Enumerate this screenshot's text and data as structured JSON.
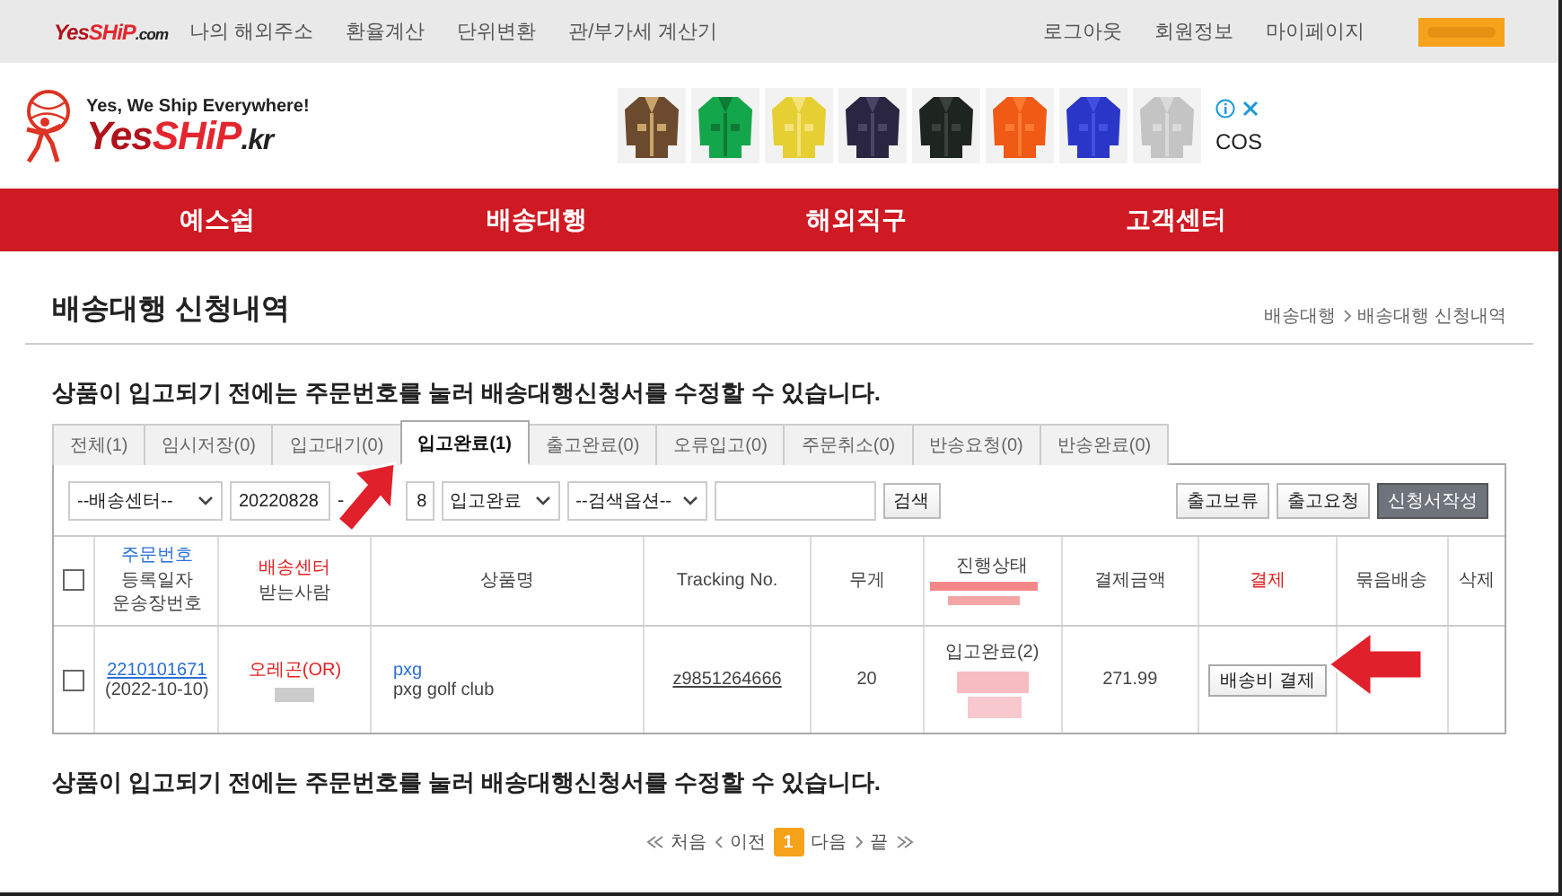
{
  "top_bar": {
    "logo_parts": [
      "Yes",
      "SHiP",
      ".com"
    ],
    "links": [
      "나의 해외주소",
      "환율계산",
      "단위변환",
      "관/부가세 계산기"
    ],
    "account_links": [
      "로그아웃",
      "회원정보",
      "마이페이지"
    ]
  },
  "header": {
    "slogan": "Yes, We Ship Everywhere!",
    "logo_parts": [
      "Yes",
      "SHiP",
      ".kr"
    ],
    "ad": {
      "brand": "COS"
    }
  },
  "nav": [
    "예스쉽",
    "배송대행",
    "해외직구",
    "고객센터"
  ],
  "page": {
    "title": "배송대행 신청내역",
    "breadcrumb": [
      "배송대행",
      "배송대행 신청내역"
    ],
    "notice": "상품이 입고되기 전에는 주문번호를 눌러 배송대행신청서를 수정할 수 있습니다.",
    "tabs": [
      {
        "label": "전체(1)",
        "selected": false
      },
      {
        "label": "임시저장(0)",
        "selected": false
      },
      {
        "label": "입고대기(0)",
        "selected": false
      },
      {
        "label": "입고완료(1)",
        "selected": true
      },
      {
        "label": "출고완료(0)",
        "selected": false
      },
      {
        "label": "오류입고(0)",
        "selected": false
      },
      {
        "label": "주문취소(0)",
        "selected": false
      },
      {
        "label": "반송요청(0)",
        "selected": false
      },
      {
        "label": "반송완료(0)",
        "selected": false
      }
    ],
    "filters": {
      "center": "--배송센터--",
      "date_from": "20220828",
      "separator": "-",
      "date_to": "8",
      "status": "입고완료",
      "option": "--검색옵션--",
      "search_button": "검색"
    },
    "actions": [
      {
        "label": "출고보류",
        "kind": "plain"
      },
      {
        "label": "출고요청",
        "kind": "plain"
      },
      {
        "label": "신청서작성",
        "kind": "primary"
      }
    ],
    "table": {
      "columns": [
        {
          "kind": "check",
          "checked": false
        },
        {
          "kind": "text",
          "lines": [
            {
              "text": "주문번호",
              "color": "#2a6fd6"
            },
            {
              "text": "등록일자",
              "color": "#444444"
            },
            {
              "text": "운송장번호",
              "color": "#444444"
            }
          ]
        },
        {
          "kind": "text",
          "lines": [
            {
              "text": "배송센터",
              "color": "#e02020"
            },
            {
              "text": "받는사람",
              "color": "#444444"
            }
          ]
        },
        {
          "kind": "text",
          "lines": [
            {
              "text": "상품명",
              "color": "#444444"
            }
          ]
        },
        {
          "kind": "text",
          "lines": [
            {
              "text": "Tracking No.",
              "color": "#444444"
            }
          ]
        },
        {
          "kind": "text",
          "lines": [
            {
              "text": "무게",
              "color": "#444444"
            }
          ]
        },
        {
          "kind": "status",
          "lines": [
            {
              "text": "진행상태",
              "color": "#444444"
            }
          ]
        },
        {
          "kind": "text",
          "lines": [
            {
              "text": "결제금액",
              "color": "#444444"
            }
          ]
        },
        {
          "kind": "text",
          "lines": [
            {
              "text": "결제",
              "color": "#e02020"
            }
          ]
        },
        {
          "kind": "text",
          "lines": [
            {
              "text": "묶음배송",
              "color": "#444444"
            }
          ]
        },
        {
          "kind": "text",
          "lines": [
            {
              "text": "삭제",
              "color": "#444444"
            }
          ]
        }
      ],
      "rows": [
        {
          "checked": false,
          "order_no": "2210101671",
          "date": "(2022-10-10)",
          "center": "오레곤(OR)",
          "product_brand": "pxg",
          "product_name": "pxg golf club",
          "tracking": "z9851264666",
          "weight": "20",
          "status": "입고완료(2)",
          "amount": "271.99",
          "pay_button": "배송비 결제"
        }
      ]
    },
    "notice_bottom": "상품이 입고되기 전에는 주문번호를 눌러 배송대행신청서를 수정할 수 있습니다.",
    "pagination": {
      "first": "처음",
      "prev": "이전",
      "pages": [
        {
          "label": "1",
          "selected": true
        }
      ],
      "next": "다음",
      "last": "끝"
    }
  }
}
